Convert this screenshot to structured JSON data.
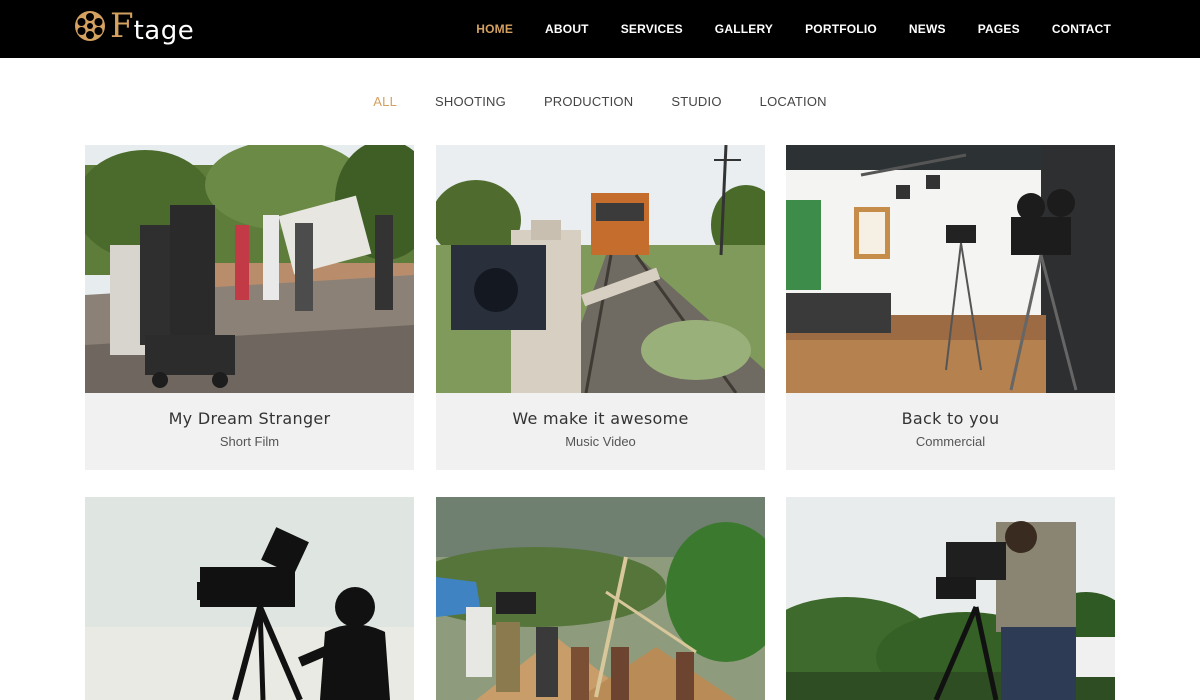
{
  "brand": {
    "logo_initial": "F",
    "logo_rest": "tage",
    "accent": "#d4a160",
    "header_bg": "#000000"
  },
  "nav": {
    "items": [
      "HOME",
      "ABOUT",
      "SERVICES",
      "GALLERY",
      "PORTFOLIO",
      "NEWS",
      "PAGES",
      "CONTACT"
    ],
    "active": "HOME"
  },
  "filters": {
    "items": [
      "ALL",
      "SHOOTING",
      "PRODUCTION",
      "STUDIO",
      "LOCATION"
    ],
    "active": "ALL"
  },
  "portfolio": [
    {
      "title": "My Dream Stranger",
      "category": "Short Film",
      "image": "street-film-crew-photo"
    },
    {
      "title": "We make it awesome",
      "category": "Music Video",
      "image": "railway-cameraman-photo"
    },
    {
      "title": "Back to you",
      "category": "Commercial",
      "image": "studio-camera-set-photo"
    },
    {
      "image": "silhouette-cameraman-photo"
    },
    {
      "image": "village-film-crew-photo"
    },
    {
      "image": "forest-cameraman-photo"
    }
  ],
  "icons": {
    "logo": "film-reel-icon"
  }
}
